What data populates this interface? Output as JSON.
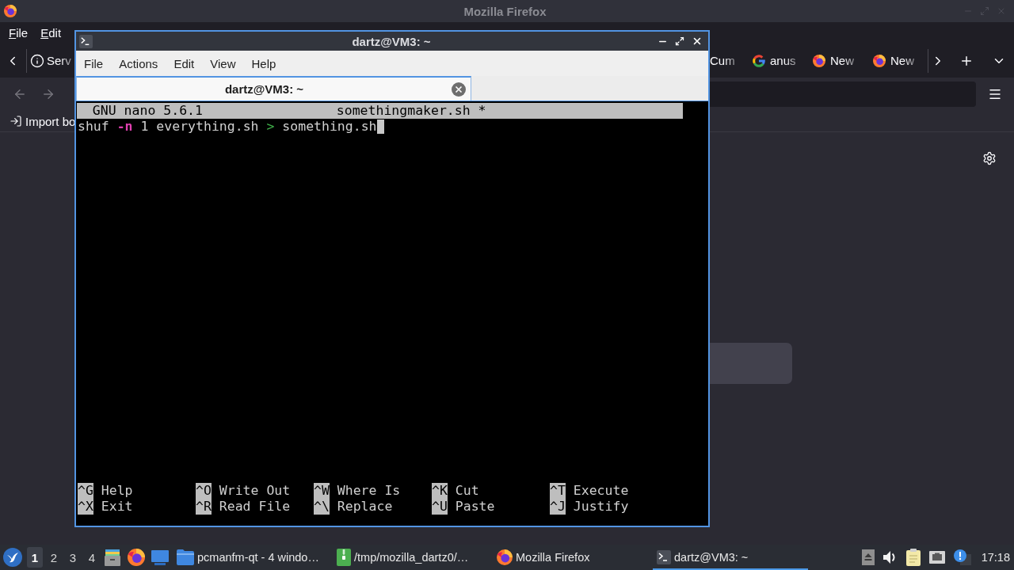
{
  "firefox": {
    "title": "Mozilla Firefox",
    "menu": [
      "File",
      "Edit"
    ],
    "tabs": [
      {
        "label": "Serv",
        "kind": "info",
        "selected": false
      },
      {
        "label": "Cum",
        "kind": "plain",
        "selected": false
      },
      {
        "label": "anus",
        "kind": "google",
        "selected": false
      },
      {
        "label": "New",
        "kind": "firefox",
        "selected": false
      },
      {
        "label": "New",
        "kind": "firefox",
        "selected": false
      }
    ],
    "nav_buttons": [
      {
        "kind": "back",
        "disabled": true
      },
      {
        "kind": "forward",
        "disabled": true
      }
    ],
    "bookmarks": [
      {
        "label": "Import bo",
        "kind": "import"
      }
    ]
  },
  "terminal": {
    "title": "dartz@VM3: ~",
    "menu": [
      "File",
      "Actions",
      "Edit",
      "View",
      "Help"
    ],
    "tabs": [
      {
        "label": "dartz@VM3: ~",
        "selected": true
      }
    ],
    "nano": {
      "version": "GNU nano 5.6.1",
      "filename": "somethingmaker.sh *",
      "lines": [
        {
          "tokens": [
            {
              "text": "shuf",
              "kind": "plain"
            },
            {
              "text": "-n",
              "kind": "option"
            },
            {
              "text": "1 everything.sh",
              "kind": "plain"
            },
            {
              "text": ">",
              "kind": "operator"
            },
            {
              "text": "something.sh",
              "kind": "plain"
            }
          ],
          "cursor": true
        }
      ],
      "shortcut_rows": [
        [
          {
            "key": "^G",
            "label": "Help"
          },
          {
            "key": "^O",
            "label": "Write Out"
          },
          {
            "key": "^W",
            "label": "Where Is"
          },
          {
            "key": "^K",
            "label": "Cut"
          },
          {
            "key": "^T",
            "label": "Execute"
          }
        ],
        [
          {
            "key": "^X",
            "label": "Exit"
          },
          {
            "key": "^R",
            "label": "Read File"
          },
          {
            "key": "^\\",
            "label": "Replace"
          },
          {
            "key": "^U",
            "label": "Paste"
          },
          {
            "key": "^J",
            "label": "Justify"
          }
        ]
      ]
    }
  },
  "taskbar": {
    "workspaces": [
      {
        "label": "1",
        "selected": true
      },
      {
        "label": "2",
        "selected": false
      },
      {
        "label": "3",
        "selected": false
      },
      {
        "label": "4",
        "selected": false
      }
    ],
    "launchers": [
      {
        "kind": "cabinet"
      },
      {
        "kind": "firefox"
      },
      {
        "kind": "desktop"
      }
    ],
    "tasks": [
      {
        "label": "pcmanfm-qt - 4 windo…",
        "kind": "folder",
        "selected": false
      },
      {
        "label": "/tmp/mozilla_dartz0/…",
        "kind": "archive",
        "selected": false
      },
      {
        "label": "Mozilla Firefox",
        "kind": "firefox",
        "selected": false
      },
      {
        "label": "dartz@VM3: ~",
        "kind": "terminal",
        "selected": true
      }
    ],
    "clock": "17:18"
  }
}
